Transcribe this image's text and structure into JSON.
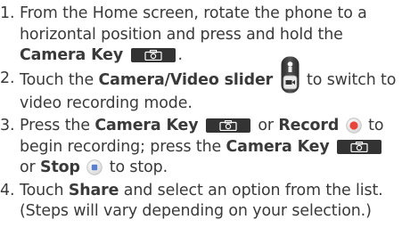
{
  "steps": [
    {
      "num": "1.",
      "t1": "From the Home screen, rotate the phone to a horizontal position and press and hold the ",
      "b1": "Camera Key",
      "t2": "."
    },
    {
      "num": "2.",
      "t1": "Touch the ",
      "b1": "Camera/Video slider",
      "t2": " to switch to video recording mode."
    },
    {
      "num": "3.",
      "t1": "Press the ",
      "b1": "Camera Key",
      "t2": " or ",
      "b2": "Record",
      "t3": " to begin recording; press the ",
      "b3": "Camera Key",
      "t4": " or ",
      "b4": "Stop",
      "t5": " to stop."
    },
    {
      "num": "4.",
      "t1": "Touch ",
      "b1": "Share",
      "t2": " and select an option from the list. (Steps will vary depending on your selection.)"
    }
  ],
  "icons": {
    "camera_key": "camera-key-icon",
    "slider": "camera-video-slider-icon",
    "record": "record-icon",
    "stop": "stop-icon"
  },
  "colors": {
    "text": "#3a3a3a",
    "key": "#333333",
    "record_red": "#e8463c",
    "stop_blue": "#5b7fcf"
  }
}
